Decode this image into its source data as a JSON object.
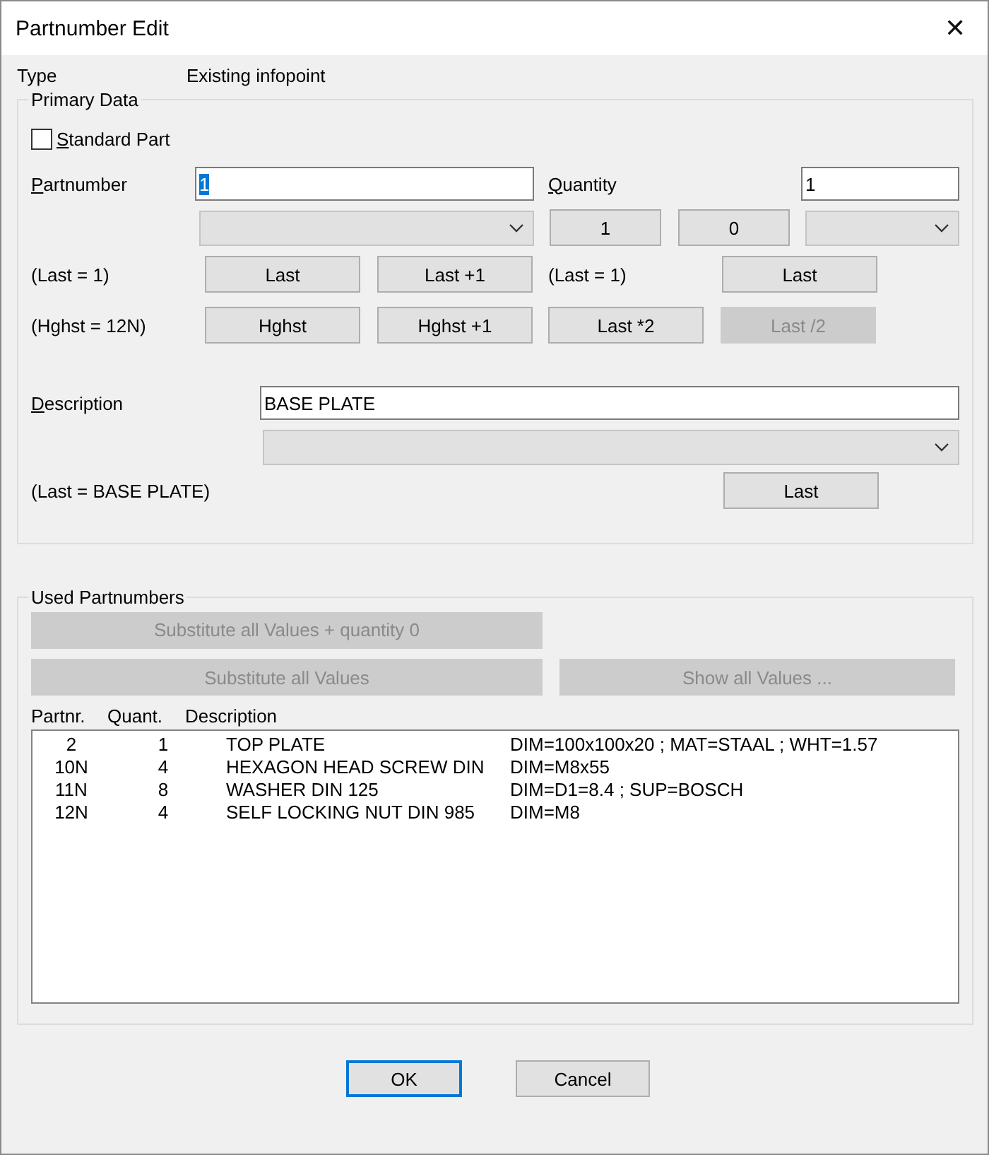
{
  "window": {
    "title": "Partnumber Edit",
    "close": "✕"
  },
  "type": {
    "label": "Type",
    "value": "Existing infopoint"
  },
  "primary_data": {
    "title": "Primary Data",
    "standard_part": {
      "label": "Standard Part",
      "checked": false
    },
    "partnumber": {
      "label": "Partnumber",
      "value": "1",
      "value_highlighted": true,
      "last_note": "(Last = 1)",
      "highest_note": "(Hghst = 12N)",
      "buttons": [
        {
          "label": "Last",
          "disabled": false
        },
        {
          "label": "Last +1",
          "disabled": false
        },
        {
          "label": "Hghst",
          "disabled": false
        },
        {
          "label": "Hghst +1",
          "disabled": false
        }
      ]
    },
    "quantity": {
      "label": "Quantity",
      "value": "1",
      "presets": [
        {
          "label": "1",
          "disabled": false
        },
        {
          "label": "0",
          "disabled": false
        }
      ],
      "last_note": "(Last = 1)",
      "buttons": [
        {
          "label": "Last",
          "disabled": false
        },
        {
          "label": "Last *2",
          "disabled": false
        },
        {
          "label": "Last /2",
          "disabled": true
        }
      ]
    },
    "description": {
      "label": "Description",
      "value": "BASE PLATE",
      "last_note": "(Last = BASE PLATE)",
      "buttons": [
        {
          "label": "Last",
          "disabled": false
        }
      ]
    }
  },
  "used_partnumbers": {
    "title": "Used Partnumbers",
    "buttons": [
      {
        "label": "Substitute all Values + quantity 0",
        "disabled": true
      },
      {
        "label": "Substitute all Values",
        "disabled": true
      },
      {
        "label": "Show all Values ...",
        "disabled": true
      }
    ],
    "columns": [
      "Partnr.",
      "Quant.",
      "Description"
    ],
    "rows": [
      {
        "cells": [
          "2",
          "1",
          "TOP PLATE",
          "DIM=100x100x20 ; MAT=STAAL ; WHT=1.57"
        ]
      },
      {
        "cells": [
          "10N",
          "4",
          "HEXAGON HEAD SCREW DIN",
          "DIM=M8x55"
        ]
      },
      {
        "cells": [
          "11N",
          "8",
          "WASHER DIN 125",
          "DIM=D1=8.4 ; SUP=BOSCH"
        ]
      },
      {
        "cells": [
          "12N",
          "4",
          "SELF LOCKING NUT DIN 985",
          "DIM=M8"
        ]
      }
    ]
  },
  "footer_buttons": [
    {
      "label": "OK",
      "default": true
    },
    {
      "label": "Cancel",
      "default": false
    }
  ]
}
